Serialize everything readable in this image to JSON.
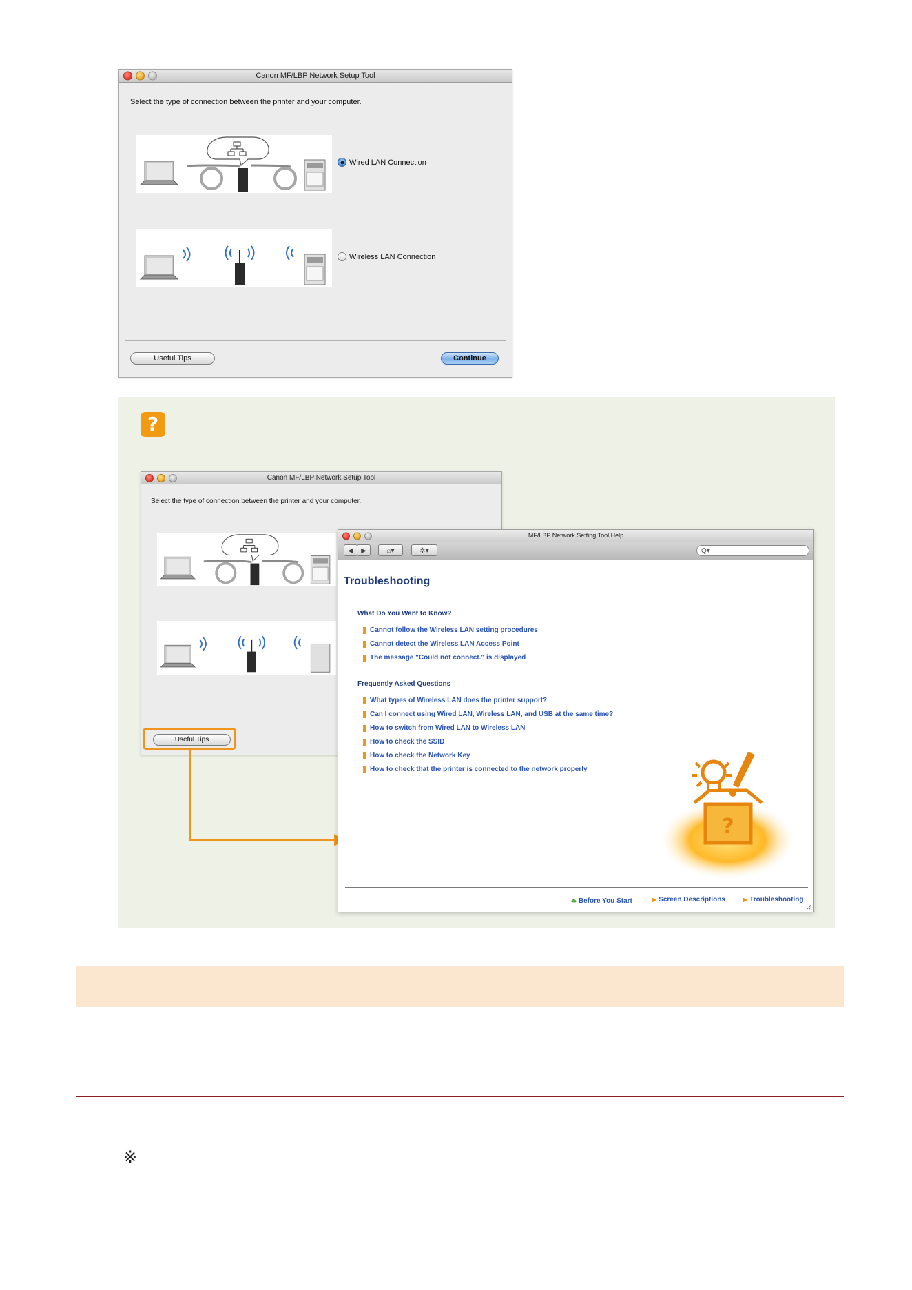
{
  "setup_window": {
    "title": "Canon MF/LBP Network Setup Tool",
    "instruction": "Select the type of connection between the printer and your computer.",
    "options": [
      {
        "label": "Wired LAN Connection",
        "selected": true
      },
      {
        "label": "Wireless LAN Connection",
        "selected": false
      }
    ],
    "useful_tips_label": "Useful Tips",
    "continue_label": "Continue"
  },
  "tip_panel": {
    "icon": "question-icon",
    "icon_glyph": "?",
    "background_color": "#eef2e6",
    "accent_color": "#f29a12"
  },
  "help_window": {
    "title": "MF/LBP Network Setting Tool Help",
    "search_glyph": "Q▾",
    "heading": "Troubleshooting",
    "section_know": "What Do You Want to Know?",
    "know_links": [
      "Cannot follow the Wireless LAN setting procedures",
      "Cannot detect the Wireless LAN Access Point",
      "The message \"Could not connect.\" is displayed"
    ],
    "section_faq": "Frequently Asked Questions",
    "faq_links": [
      "What types of Wireless LAN does the printer support?",
      "Can I connect using Wired LAN, Wireless LAN, and USB at the same time?",
      "How to switch from Wired LAN to Wireless LAN",
      "How to check the SSID",
      "How to check the Network Key",
      "How to check that the printer is connected to the network properly"
    ],
    "footer_links": [
      "Before You Start",
      "Screen Descriptions",
      "Troubleshooting"
    ],
    "link_color": "#2a54b0",
    "heading_color": "#1d3a7d"
  },
  "page": {
    "band_color": "#fbe7d0",
    "rule_color": "#8e1d24",
    "reference_mark": "※"
  }
}
